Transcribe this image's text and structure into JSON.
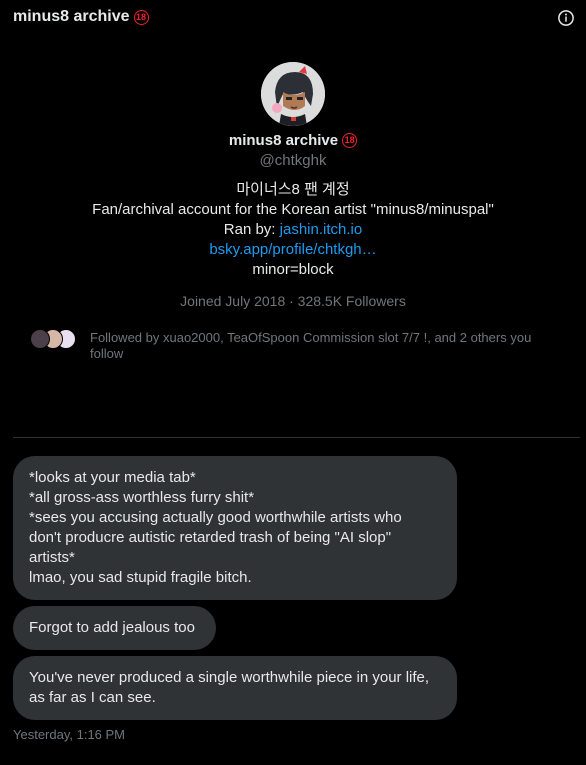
{
  "header": {
    "title": "minus8 archive",
    "badge": "18"
  },
  "profile": {
    "display_name": "minus8 archive",
    "badge": "18",
    "handle": "@chtkghk",
    "bio": {
      "line1": "마이너스8 팬 계정",
      "line2": "Fan/archival account for the Korean artist \"minus8/minuspal\"",
      "line3_prefix": "Ran by: ",
      "line3_link": "jashin.itch.io",
      "line4_link": "bsky.app/profile/chtkgh…",
      "line5": "minor=block"
    },
    "meta": "Joined July 2018 · 328.5K Followers",
    "followed_by": "Followed by xuao2000, TeaOfSpoon Commission slot 7/7 !, and 2 others you follow"
  },
  "messages": [
    {
      "lines": [
        "*looks at your media tab*",
        "*all gross-ass worthless furry shit*",
        "*sees you accusing actually good worthwhile artists who",
        "don't producre autistic retarded trash of being \"AI slop\"",
        "artists*",
        "lmao, you sad stupid fragile bitch."
      ]
    },
    {
      "lines": [
        "Forgot to add jealous too"
      ]
    },
    {
      "lines": [
        "You've never produced a single worthwhile piece in your life,",
        "as far as I can see."
      ]
    }
  ],
  "timestamp": "Yesterday, 1:16 PM",
  "colors": {
    "background": "#000000",
    "bubble": "#2f3336",
    "link": "#1d9bf0",
    "muted": "#71767b",
    "badge_red": "#f4212e"
  },
  "icons": {
    "info": "info-icon",
    "age_badge": "18-plus-badge"
  }
}
